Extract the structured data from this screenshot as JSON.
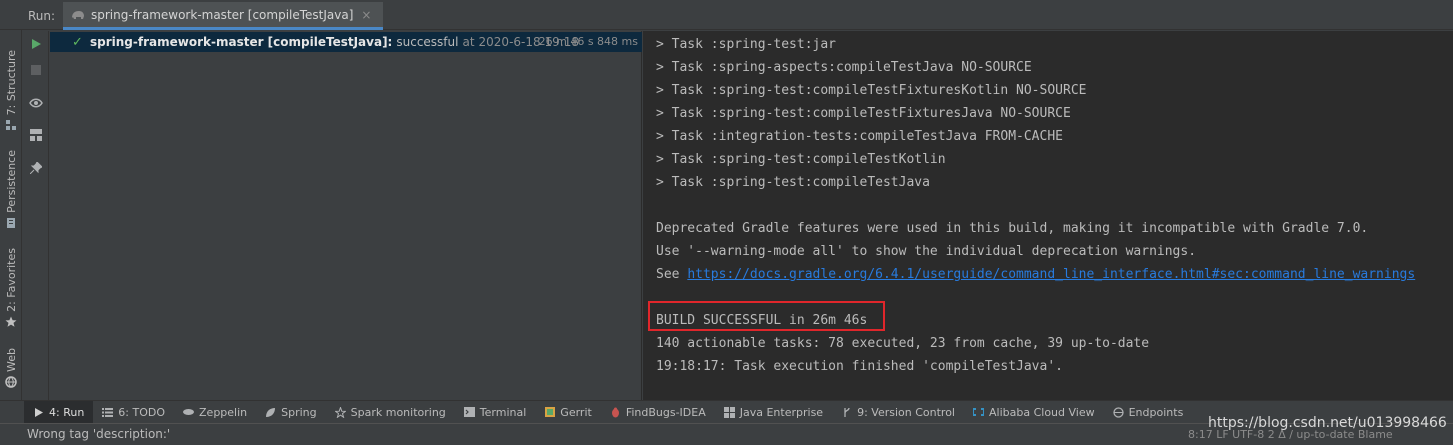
{
  "run_header": {
    "label": "Run:",
    "tab_title": "spring-framework-master [compileTestJava]",
    "close_glyph": "×"
  },
  "left_stripe": {
    "tabs": [
      {
        "label": "7: Structure",
        "icon": "structure-icon"
      },
      {
        "label": "Persistence",
        "icon": "persistence-icon"
      },
      {
        "label": "2: Favorites",
        "icon": "star-icon"
      },
      {
        "label": "Web",
        "icon": "globe-icon"
      }
    ]
  },
  "tree": {
    "name": "spring-framework-master [compileTestJava]:",
    "status": "successful",
    "at": "at",
    "time": "2020-6-18 19:18",
    "duration": "26 m 46 s 848 ms"
  },
  "console": {
    "lines": [
      "> Task :spring-test:jar",
      "> Task :spring-aspects:compileTestJava NO-SOURCE",
      "> Task :spring-test:compileTestFixturesKotlin NO-SOURCE",
      "> Task :spring-test:compileTestFixturesJava NO-SOURCE",
      "> Task :integration-tests:compileTestJava FROM-CACHE",
      "> Task :spring-test:compileTestKotlin",
      "> Task :spring-test:compileTestJava",
      "Deprecated Gradle features were used in this build, making it incompatible with Gradle 7.0.",
      "Use '--warning-mode all' to show the individual deprecation warnings.",
      "See ",
      "BUILD SUCCESSFUL in 26m 46s",
      "140 actionable tasks: 78 executed, 23 from cache, 39 up-to-date",
      "19:18:17: Task execution finished 'compileTestJava'."
    ],
    "link": "https://docs.gradle.org/6.4.1/userguide/command_line_interface.html#sec:command_line_warnings"
  },
  "bottom_bar": {
    "tabs": [
      {
        "label": "4: Run",
        "icon": "run-icon",
        "active": true
      },
      {
        "label": "6: TODO",
        "icon": "todo-icon"
      },
      {
        "label": "Zeppelin",
        "icon": "zeppelin-icon"
      },
      {
        "label": "Spring",
        "icon": "spring-icon"
      },
      {
        "label": "Spark monitoring",
        "icon": "spark-icon"
      },
      {
        "label": "Terminal",
        "icon": "terminal-icon"
      },
      {
        "label": "Gerrit",
        "icon": "gerrit-icon"
      },
      {
        "label": "FindBugs-IDEA",
        "icon": "bug-icon"
      },
      {
        "label": "Java Enterprise",
        "icon": "java-enterprise-icon"
      },
      {
        "label": "9: Version Control",
        "icon": "version-control-icon"
      },
      {
        "label": "Alibaba Cloud View",
        "icon": "alibaba-cloud-icon"
      },
      {
        "label": "Endpoints",
        "icon": "endpoints-icon"
      }
    ]
  },
  "status_bar": {
    "message": "Wrong tag 'description:'",
    "right": "8:17  LF  UTF-8  2 Δ / up-to-date  Blame"
  },
  "watermark": "https://blog.csdn.net/u013998466",
  "colors": {
    "accent": "#4a88c7",
    "success": "#5fb85f",
    "link": "#287bde",
    "highlight_box": "#e0262b"
  }
}
